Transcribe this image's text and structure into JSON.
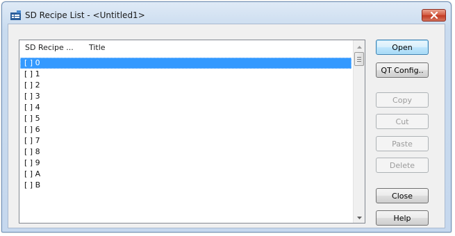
{
  "window": {
    "title": "SD Recipe List - <Untitled1>",
    "app_icon": "recipe-list-icon",
    "close_icon": "close-icon"
  },
  "list": {
    "columns": [
      "SD Recipe ...",
      "Title"
    ],
    "rows": [
      "[ ] 0",
      "[ ] 1",
      "[ ] 2",
      "[ ] 3",
      "[ ] 4",
      "[ ] 5",
      "[ ] 6",
      "[ ] 7",
      "[ ] 8",
      "[ ] 9",
      "[ ] A",
      "[ ] B"
    ],
    "selected_index": 0
  },
  "buttons": {
    "open": "Open",
    "qt_config": "QT Config..",
    "copy": "Copy",
    "cut": "Cut",
    "paste": "Paste",
    "delete": "Delete",
    "close": "Close",
    "help": "Help"
  },
  "colors": {
    "selection": "#3399ff",
    "close_button": "#c23a22"
  }
}
